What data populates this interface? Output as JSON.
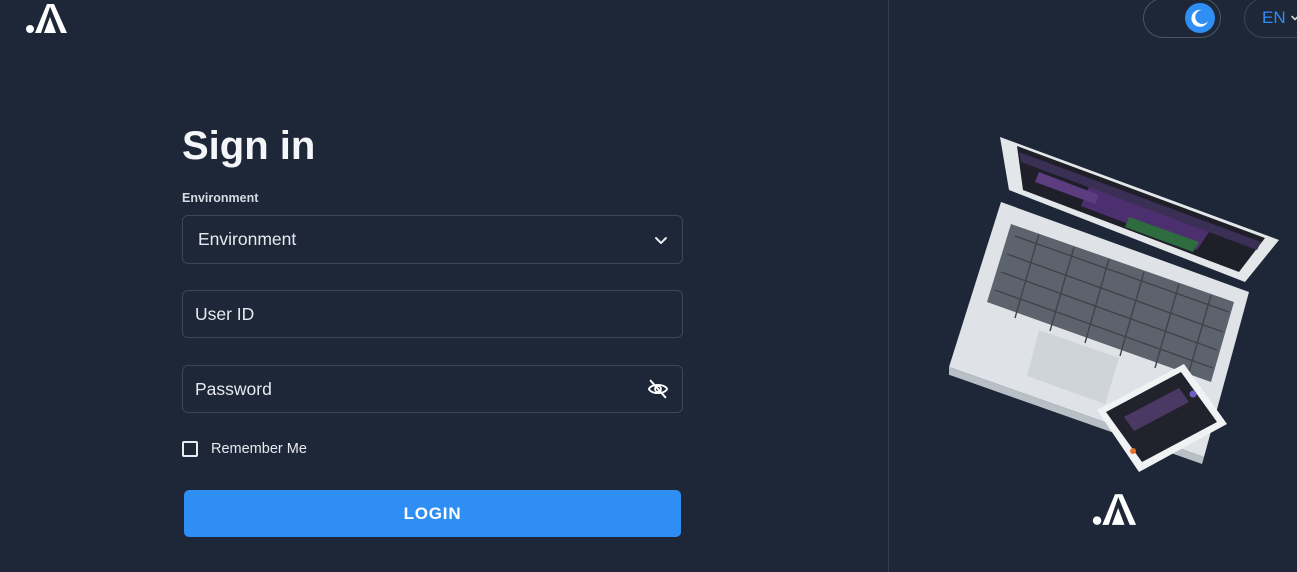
{
  "header": {
    "logo_icon": "brand-logo-icon",
    "theme_toggle_icon": "moon-icon",
    "language": "EN"
  },
  "form": {
    "title": "Sign in",
    "environment_caption": "Environment",
    "environment_value": "Environment",
    "user_id_placeholder": "User ID",
    "password_placeholder": "Password",
    "password_toggle_icon": "eye-off-icon",
    "remember_label": "Remember Me",
    "remember_checked": false,
    "login_label": "LOGIN"
  },
  "colors": {
    "background": "#1e2737",
    "accent": "#2f8ef4",
    "border": "#3b4658",
    "text": "#f2f4f8"
  }
}
